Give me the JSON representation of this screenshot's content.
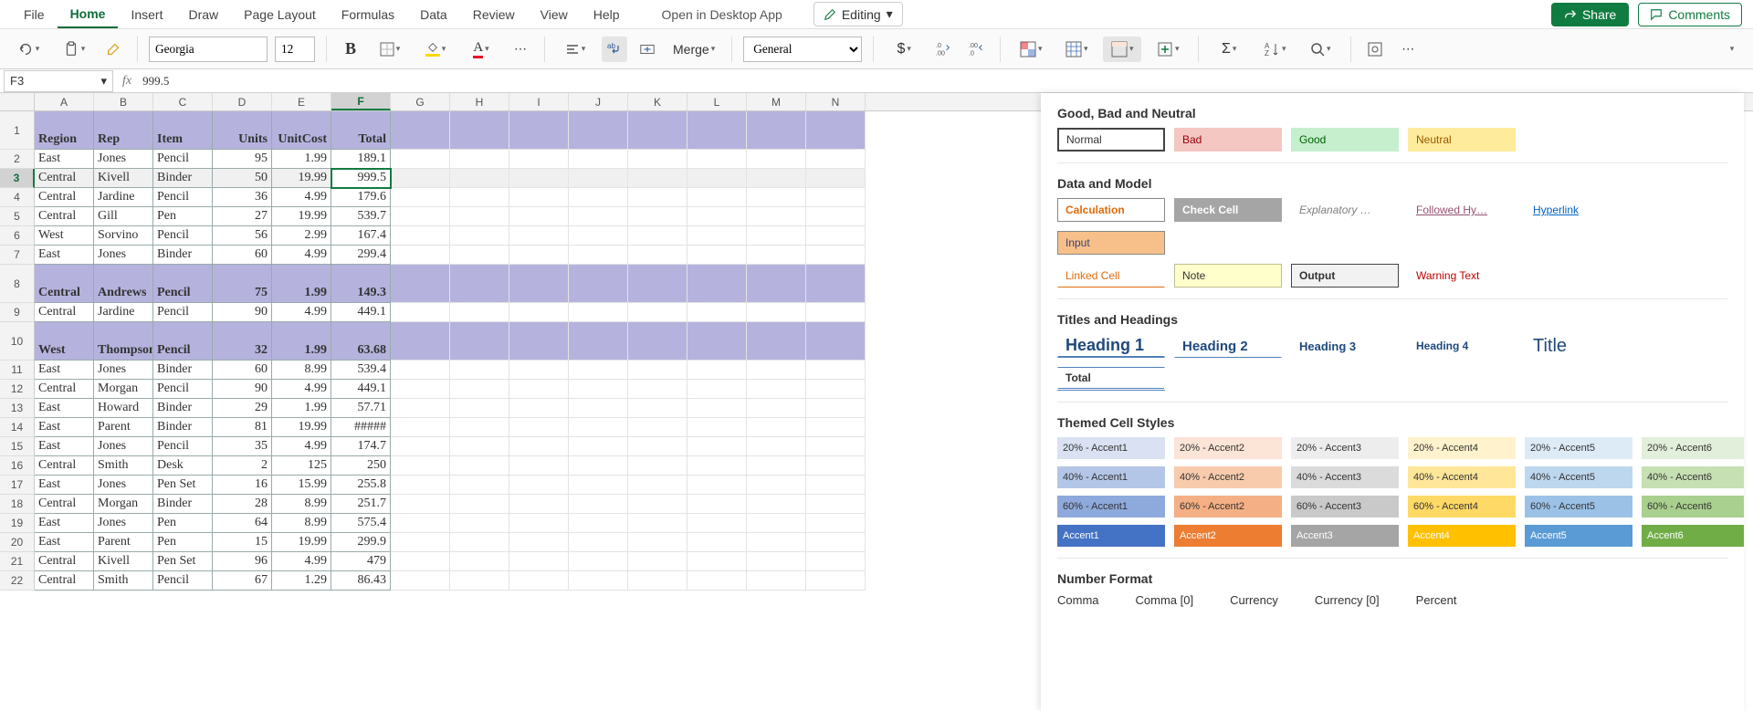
{
  "menu": {
    "file": "File",
    "home": "Home",
    "insert": "Insert",
    "draw": "Draw",
    "pagelayout": "Page Layout",
    "formulas": "Formulas",
    "data": "Data",
    "review": "Review",
    "view": "View",
    "help": "Help",
    "desktop": "Open in Desktop App",
    "editing": "Editing",
    "share": "Share",
    "comments": "Comments"
  },
  "ribbon": {
    "font": "Georgia",
    "size": "12",
    "bold": "B",
    "merge": "Merge",
    "numfmt": "General"
  },
  "namebox": "F3",
  "formula": "999.5",
  "cols": [
    "A",
    "B",
    "C",
    "D",
    "E",
    "F",
    "G",
    "H",
    "I",
    "J",
    "K",
    "L",
    "M",
    "N"
  ],
  "headers": [
    "Region",
    "Rep",
    "Item",
    "Units",
    "UnitCost",
    "Total"
  ],
  "rows": [
    [
      "East",
      "Jones",
      "Pencil",
      "95",
      "1.99",
      "189.1"
    ],
    [
      "Central",
      "Kivell",
      "Binder",
      "50",
      "19.99",
      "999.5"
    ],
    [
      "Central",
      "Jardine",
      "Pencil",
      "36",
      "4.99",
      "179.6"
    ],
    [
      "Central",
      "Gill",
      "Pen",
      "27",
      "19.99",
      "539.7"
    ],
    [
      "West",
      "Sorvino",
      "Pencil",
      "56",
      "2.99",
      "167.4"
    ],
    [
      "East",
      "Jones",
      "Binder",
      "60",
      "4.99",
      "299.4"
    ],
    [
      "Central",
      "Andrews",
      "Pencil",
      "75",
      "1.99",
      "149.3"
    ],
    [
      "Central",
      "Jardine",
      "Pencil",
      "90",
      "4.99",
      "449.1"
    ],
    [
      "West",
      "Thompson",
      "Pencil",
      "32",
      "1.99",
      "63.68"
    ],
    [
      "East",
      "Jones",
      "Binder",
      "60",
      "8.99",
      "539.4"
    ],
    [
      "Central",
      "Morgan",
      "Pencil",
      "90",
      "4.99",
      "449.1"
    ],
    [
      "East",
      "Howard",
      "Binder",
      "29",
      "1.99",
      "57.71"
    ],
    [
      "East",
      "Parent",
      "Binder",
      "81",
      "19.99",
      "#####"
    ],
    [
      "East",
      "Jones",
      "Pencil",
      "35",
      "4.99",
      "174.7"
    ],
    [
      "Central",
      "Smith",
      "Desk",
      "2",
      "125",
      "250"
    ],
    [
      "East",
      "Jones",
      "Pen Set",
      "16",
      "15.99",
      "255.8"
    ],
    [
      "Central",
      "Morgan",
      "Binder",
      "28",
      "8.99",
      "251.7"
    ],
    [
      "East",
      "Jones",
      "Pen",
      "64",
      "8.99",
      "575.4"
    ],
    [
      "East",
      "Parent",
      "Pen",
      "15",
      "19.99",
      "299.9"
    ],
    [
      "Central",
      "Kivell",
      "Pen Set",
      "96",
      "4.99",
      "479"
    ],
    [
      "Central",
      "Smith",
      "Pencil",
      "67",
      "1.29",
      "86.43"
    ]
  ],
  "panel": {
    "sec1": "Good, Bad and Neutral",
    "normal": "Normal",
    "bad": "Bad",
    "good": "Good",
    "neutral": "Neutral",
    "sec2": "Data and Model",
    "calc": "Calculation",
    "check": "Check Cell",
    "expl": "Explanatory …",
    "fhyp": "Followed Hy…",
    "hyp": "Hyperlink",
    "input": "Input",
    "linked": "Linked Cell",
    "note": "Note",
    "output": "Output",
    "warn": "Warning Text",
    "sec3": "Titles and Headings",
    "h1": "Heading 1",
    "h2": "Heading 2",
    "h3": "Heading 3",
    "h4": "Heading 4",
    "title": "Title",
    "total": "Total",
    "sec4": "Themed Cell Styles",
    "sec5": "Number Format",
    "nf": [
      "Comma",
      "Comma [0]",
      "Currency",
      "Currency [0]",
      "Percent"
    ],
    "accLabels": {
      "p20": "20% - Accent",
      "p40": "40% - Accent",
      "p60": "60% - Accent",
      "full": "Accent"
    },
    "accentColors": {
      "full": [
        "#4472c4",
        "#ed7d31",
        "#a5a5a5",
        "#ffc000",
        "#5b9bd5",
        "#70ad47"
      ],
      "p60": [
        "#8ea9db",
        "#f4b084",
        "#c9c9c9",
        "#ffd966",
        "#9bc2e6",
        "#a9d08e"
      ],
      "p40": [
        "#b4c6e7",
        "#f8cbad",
        "#dbdbdb",
        "#ffe699",
        "#bdd7ee",
        "#c6e0b4"
      ],
      "p20": [
        "#d9e1f2",
        "#fce4d6",
        "#ededed",
        "#fff2cc",
        "#ddebf7",
        "#e2efda"
      ]
    }
  }
}
